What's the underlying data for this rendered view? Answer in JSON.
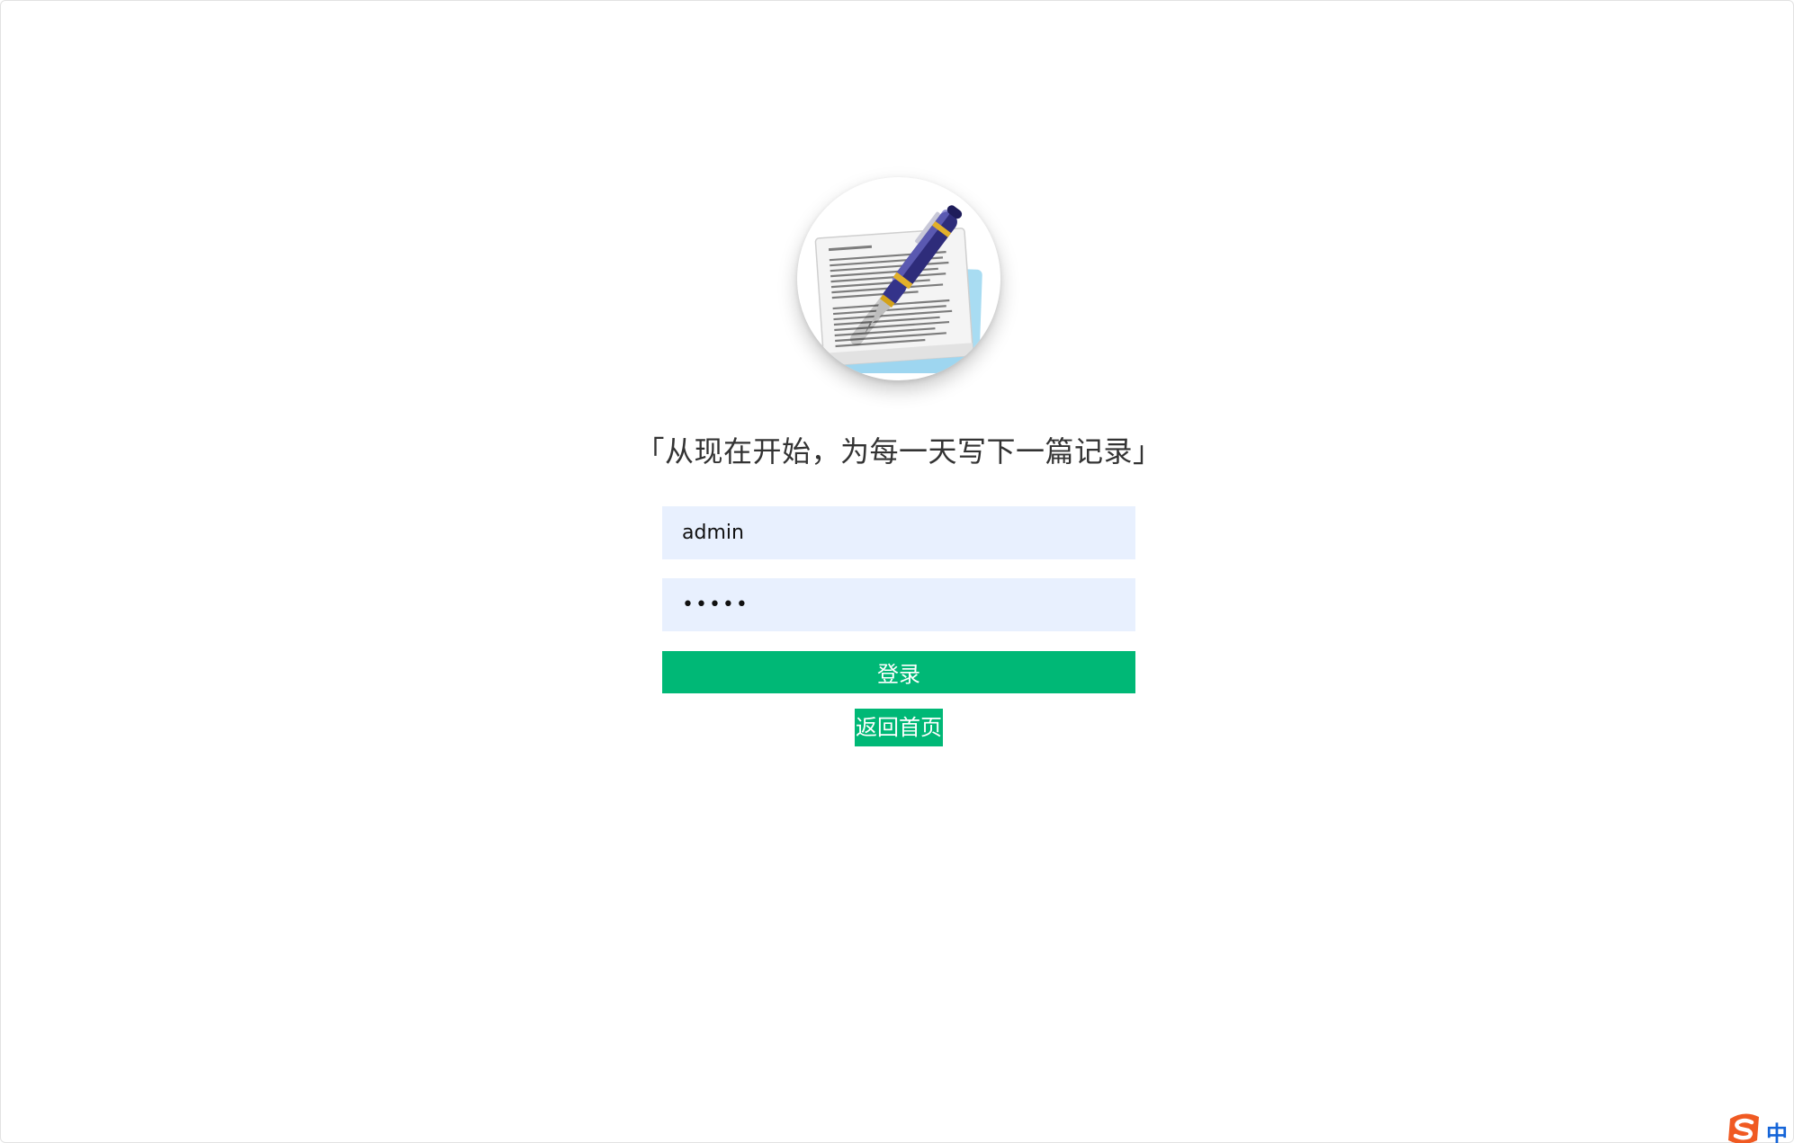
{
  "login": {
    "slogan": "「从现在开始，为每一天写下一篇记录」",
    "username_value": "admin",
    "password_value": "•••••",
    "login_button": "登录",
    "home_link": "返回首页"
  },
  "avatar": {
    "icon": "pen-document-icon"
  },
  "ime": {
    "label": "中",
    "icon": "sogou-s-icon"
  },
  "colors": {
    "primary": "#00b876",
    "field_bg": "#e8f0fe",
    "text": "#333333",
    "ime_blue": "#1565d8",
    "ime_orange": "#f05a22"
  }
}
